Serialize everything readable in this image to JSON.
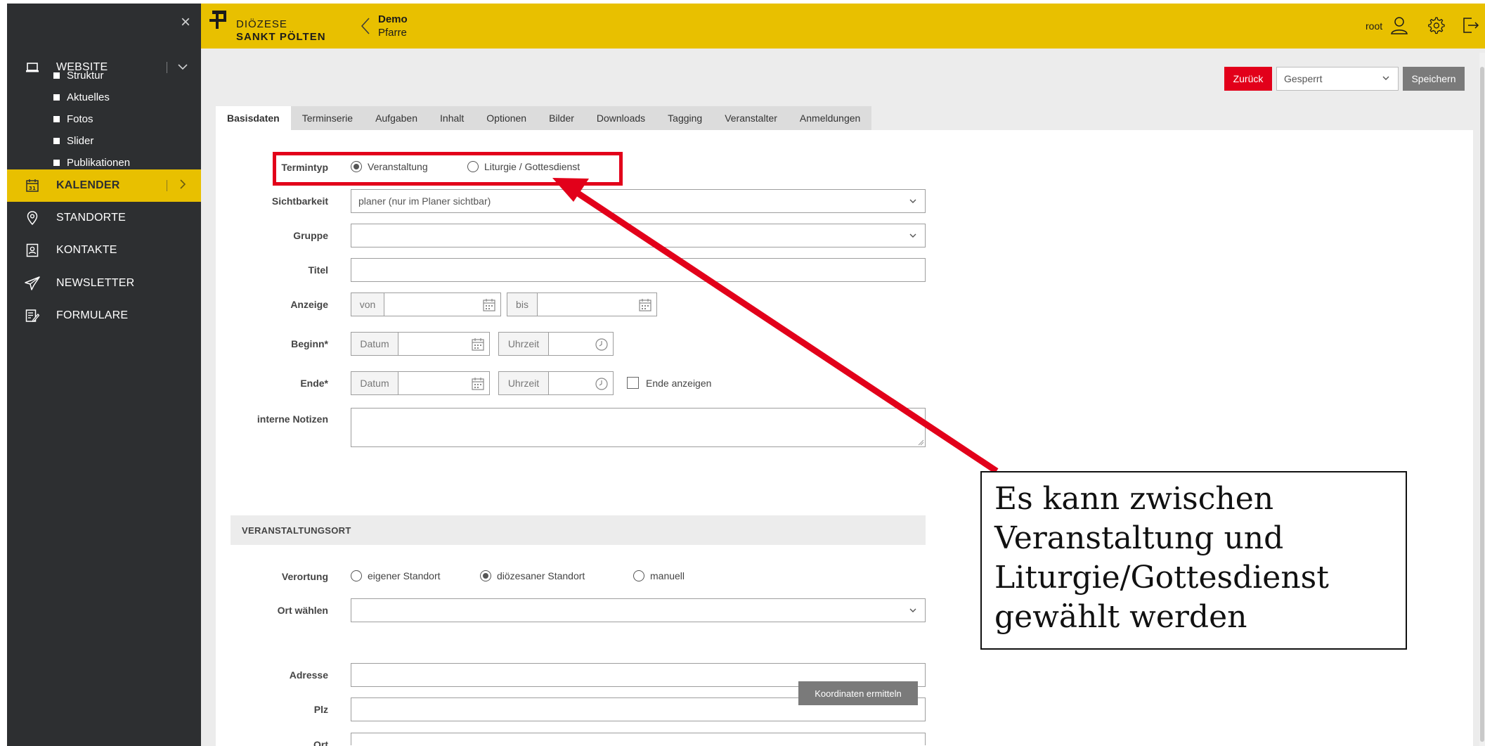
{
  "sidebar": {
    "close_icon": "close-icon",
    "items": [
      {
        "label": "WEBSITE",
        "icon": "laptop-icon",
        "active": false,
        "sub": [
          {
            "label": "Struktur"
          },
          {
            "label": "Aktuelles"
          },
          {
            "label": "Fotos"
          },
          {
            "label": "Slider"
          },
          {
            "label": "Publikationen"
          }
        ]
      },
      {
        "label": "KALENDER",
        "icon": "calendar-icon",
        "active": true
      },
      {
        "label": "STANDORTE",
        "icon": "location-pin-icon"
      },
      {
        "label": "KONTAKTE",
        "icon": "contact-card-icon"
      },
      {
        "label": "NEWSLETTER",
        "icon": "paper-plane-icon"
      },
      {
        "label": "FORMULARE",
        "icon": "form-edit-icon"
      }
    ]
  },
  "header": {
    "logo_line1": "DIÖZESE",
    "logo_line2": "SANKT PÖLTEN",
    "site_name": "Demo",
    "site_sub": "Pfarre",
    "user": "root",
    "colors": {
      "accent": "#e8c000",
      "sidebar": "#2d2f31",
      "danger": "#e2001a"
    }
  },
  "toolbar": {
    "back_label": "Zurück",
    "status_value": "Gesperrt",
    "save_label": "Speichern"
  },
  "tabs": [
    "Basisdaten",
    "Terminserie",
    "Aufgaben",
    "Inhalt",
    "Optionen",
    "Bilder",
    "Downloads",
    "Tagging",
    "Veranstalter",
    "Anmeldungen"
  ],
  "form": {
    "termintyp": {
      "label": "Termintyp",
      "options": [
        "Veranstaltung",
        "Liturgie / Gottesdienst"
      ],
      "selected": "Veranstaltung"
    },
    "sichtbarkeit": {
      "label": "Sichtbarkeit",
      "value": "planer (nur im Planer sichtbar)"
    },
    "gruppe": {
      "label": "Gruppe",
      "value": ""
    },
    "titel": {
      "label": "Titel",
      "value": ""
    },
    "anzeige": {
      "label": "Anzeige",
      "von": "von",
      "bis": "bis"
    },
    "beginn": {
      "label": "Beginn*",
      "datum": "Datum",
      "uhrzeit": "Uhrzeit"
    },
    "ende": {
      "label": "Ende*",
      "datum": "Datum",
      "uhrzeit": "Uhrzeit",
      "show_end": "Ende anzeigen"
    },
    "notizen": {
      "label": "interne Notizen",
      "value": ""
    }
  },
  "ort": {
    "section_title": "VERANSTALTUNGSORT",
    "verortung": {
      "label": "Verortung",
      "options": [
        "eigener Standort",
        "diözesaner Standort",
        "manuell"
      ],
      "selected": "diözesaner Standort"
    },
    "ort_waehlen": {
      "label": "Ort wählen",
      "value": ""
    },
    "adresse": {
      "label": "Adresse",
      "value": ""
    },
    "plz": {
      "label": "Plz",
      "value": ""
    },
    "ort": {
      "label": "Ort",
      "value": ""
    },
    "coords_button": "Koordinaten ermitteln"
  },
  "annotation": {
    "text_lines": [
      "Es kann zwischen",
      "Veranstaltung und",
      "Liturgie/Gottesdienst",
      "gewählt werden"
    ]
  }
}
